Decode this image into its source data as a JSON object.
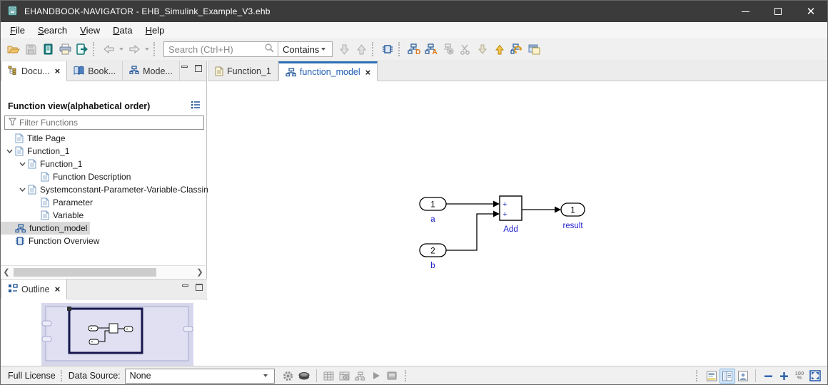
{
  "window": {
    "title": "EHANDBOOK-NAVIGATOR - EHB_Simulink_Example_V3.ehb"
  },
  "menu": {
    "items": [
      {
        "label": "File"
      },
      {
        "label": "Search"
      },
      {
        "label": "View"
      },
      {
        "label": "Data"
      },
      {
        "label": "Help"
      }
    ]
  },
  "toolbar": {
    "search_placeholder": "Search (Ctrl+H)",
    "contains_label": "Contains",
    "icons": [
      "open-handbook",
      "save",
      "handbook",
      "print",
      "export-handbook",
      "nav-back",
      "nav-forward",
      "search",
      "jump-down",
      "jump-up",
      "model-navigate",
      "model-data-d",
      "model-annotation-a",
      "model-remove",
      "model-cut",
      "import-arrow",
      "export-arrow",
      "model-reload",
      "open-panels"
    ]
  },
  "left_tabs": {
    "items": [
      {
        "label": "Docu..."
      },
      {
        "label": "Book..."
      },
      {
        "label": "Mode..."
      }
    ]
  },
  "function_view": {
    "header": "Function view(alphabetical order)",
    "filter_placeholder": "Filter Functions",
    "tree": [
      {
        "label": "Title Page",
        "icon": "document"
      },
      {
        "label": "Function_1",
        "icon": "document",
        "expanded": true
      },
      {
        "label": "Function_1",
        "icon": "document",
        "expanded": true
      },
      {
        "label": "Function Description",
        "icon": "document"
      },
      {
        "label": "Systemconstant-Parameter-Variable-Classin",
        "icon": "document",
        "expanded": true
      },
      {
        "label": "Parameter",
        "icon": "document"
      },
      {
        "label": "Variable",
        "icon": "document"
      },
      {
        "label": "function_model",
        "icon": "model",
        "selected": true
      },
      {
        "label": "Function Overview",
        "icon": "chip"
      }
    ]
  },
  "outline": {
    "label": "Outline"
  },
  "editor": {
    "tabs": [
      {
        "label": "Function_1",
        "icon": "document"
      },
      {
        "label": "function_model",
        "icon": "model",
        "active": true
      }
    ]
  },
  "diagram": {
    "input_a": {
      "port": "1",
      "label": "a"
    },
    "input_b": {
      "port": "2",
      "label": "b"
    },
    "add": {
      "label": "Add",
      "sign_top": "+",
      "sign_bottom": "+"
    },
    "output": {
      "port": "1",
      "label": "result"
    }
  },
  "statusbar": {
    "license": "Full License",
    "data_source_label": "Data Source:",
    "data_source_value": "None",
    "zoom_value": "100",
    "zoom_unit": "%"
  },
  "colors": {
    "titlebar": "#3b3b3b",
    "accent_blue": "#2d6fb5",
    "tab_text_blue": "#1e5cb3",
    "diagram_label_blue": "#2222cc",
    "selection_gray": "#d9d9d9",
    "thumbnail_lavender": "#d7d7ec",
    "icon_teal": "#157575",
    "icon_orange": "#e7a12f"
  }
}
